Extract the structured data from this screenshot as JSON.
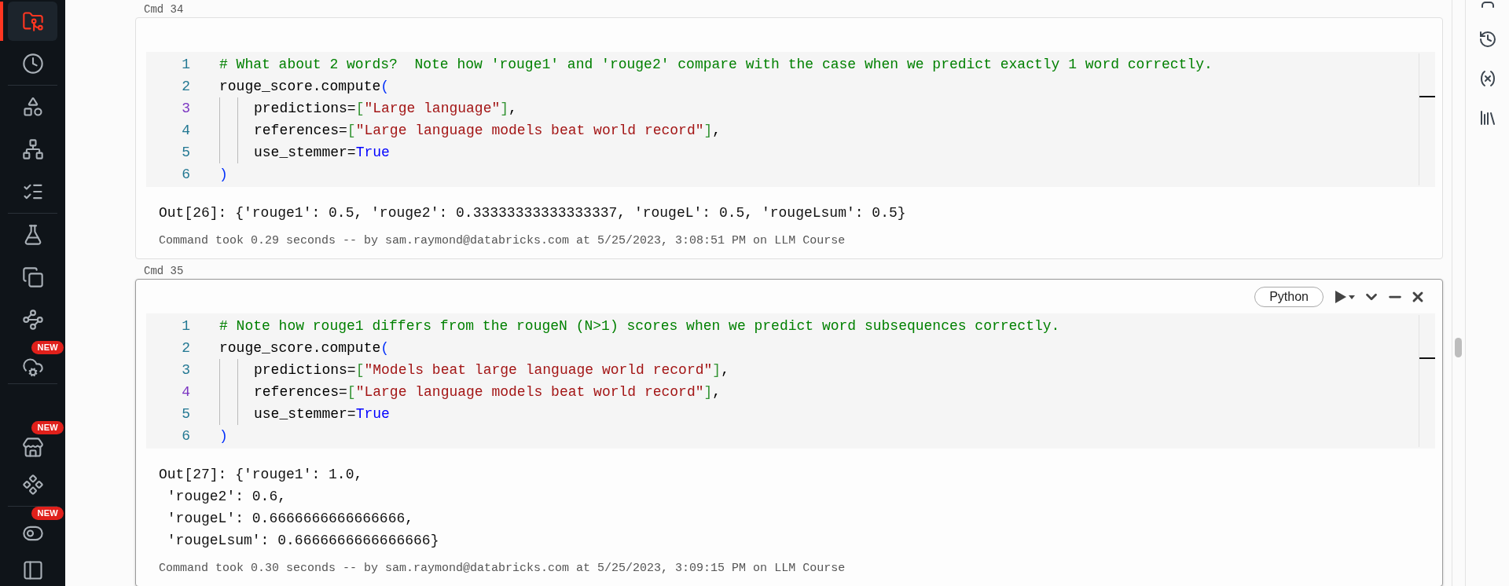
{
  "sidebar": {
    "groups": [
      [
        {
          "selected": true
        },
        {
          "selected": false
        }
      ],
      [
        {
          "selected": false
        },
        {
          "selected": false
        },
        {
          "selected": false
        }
      ],
      [
        {
          "selected": false
        },
        {
          "selected": false
        },
        {
          "selected": false
        },
        {
          "selected": false,
          "badge": "NEW"
        }
      ],
      [
        {
          "selected": false,
          "badge": "NEW"
        },
        {
          "selected": false
        }
      ],
      [
        {
          "selected": false,
          "badge": "NEW"
        },
        {
          "selected": false
        }
      ]
    ]
  },
  "cells": [
    {
      "label": "Cmd 34",
      "focused": false,
      "lines": [
        {
          "number": "1",
          "active": false,
          "indented": false,
          "tokens": [
            {
              "kind": "comment",
              "text": "# What about 2 words?  Note how 'rouge1' and 'rouge2' compare with the case when we predict exactly 1 word correctly."
            }
          ]
        },
        {
          "number": "2",
          "active": false,
          "indented": false,
          "tokens": [
            {
              "kind": "plain",
              "text": "rouge_score.compute"
            },
            {
              "kind": "paren",
              "text": "("
            }
          ]
        },
        {
          "number": "3",
          "active": true,
          "indented": true,
          "tokens": [
            {
              "kind": "plain",
              "text": "predictions="
            },
            {
              "kind": "bracket",
              "text": "["
            },
            {
              "kind": "string",
              "text": "\"Large language\""
            },
            {
              "kind": "bracket",
              "text": "]"
            },
            {
              "kind": "plain",
              "text": ","
            }
          ]
        },
        {
          "number": "4",
          "active": false,
          "indented": true,
          "tokens": [
            {
              "kind": "plain",
              "text": "references="
            },
            {
              "kind": "bracket",
              "text": "["
            },
            {
              "kind": "string",
              "text": "\"Large language models beat world record\""
            },
            {
              "kind": "bracket",
              "text": "]"
            },
            {
              "kind": "plain",
              "text": ","
            }
          ]
        },
        {
          "number": "5",
          "active": false,
          "indented": true,
          "tokens": [
            {
              "kind": "plain",
              "text": "use_stemmer="
            },
            {
              "kind": "keyword",
              "text": "True"
            }
          ]
        },
        {
          "number": "6",
          "active": false,
          "indented": false,
          "tokens": [
            {
              "kind": "paren",
              "text": ")"
            }
          ]
        }
      ],
      "output": [
        "Out[26]: {'rouge1': 0.5, 'rouge2': 0.33333333333333337, 'rougeL': 0.5, 'rougeLsum': 0.5}"
      ],
      "footer": "Command took 0.29 seconds -- by sam.raymond@databricks.com at 5/25/2023, 3:08:51 PM on LLM Course"
    },
    {
      "label": "Cmd 35",
      "focused": true,
      "language": "Python",
      "lines": [
        {
          "number": "1",
          "active": false,
          "indented": false,
          "tokens": [
            {
              "kind": "comment",
              "text": "# Note how rouge1 differs from the rougeN (N>1) scores when we predict word subsequences correctly."
            }
          ]
        },
        {
          "number": "2",
          "active": false,
          "indented": false,
          "tokens": [
            {
              "kind": "plain",
              "text": "rouge_score.compute"
            },
            {
              "kind": "paren",
              "text": "("
            }
          ]
        },
        {
          "number": "3",
          "active": false,
          "indented": true,
          "tokens": [
            {
              "kind": "plain",
              "text": "predictions="
            },
            {
              "kind": "bracket",
              "text": "["
            },
            {
              "kind": "string",
              "text": "\"Models beat large language world record\""
            },
            {
              "kind": "bracket",
              "text": "]"
            },
            {
              "kind": "plain",
              "text": ","
            }
          ]
        },
        {
          "number": "4",
          "active": true,
          "indented": true,
          "tokens": [
            {
              "kind": "plain",
              "text": "references="
            },
            {
              "kind": "bracket",
              "text": "["
            },
            {
              "kind": "string",
              "text": "\"Large language models beat world record\""
            },
            {
              "kind": "bracket",
              "text": "]"
            },
            {
              "kind": "plain",
              "text": ","
            }
          ]
        },
        {
          "number": "5",
          "active": false,
          "indented": true,
          "tokens": [
            {
              "kind": "plain",
              "text": "use_stemmer="
            },
            {
              "kind": "keyword",
              "text": "True"
            }
          ]
        },
        {
          "number": "6",
          "active": false,
          "indented": false,
          "tokens": [
            {
              "kind": "paren",
              "text": ")"
            }
          ]
        }
      ],
      "output": [
        "Out[27]: {'rouge1': 1.0,",
        " 'rouge2': 0.6,",
        " 'rougeL': 0.6666666666666666,",
        " 'rougeLsum': 0.6666666666666666}"
      ],
      "footer": "Command took 0.30 seconds -- by sam.raymond@databricks.com at 5/25/2023, 3:09:15 PM on LLM Course"
    }
  ]
}
